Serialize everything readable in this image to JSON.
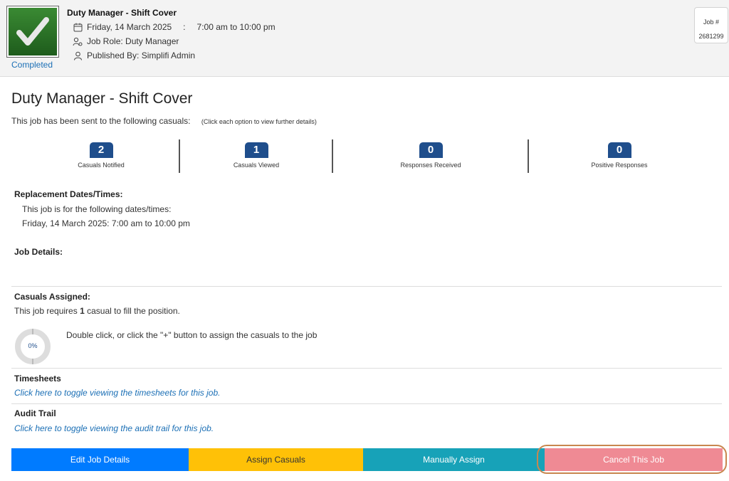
{
  "header": {
    "status_label": "Completed",
    "title": "Duty Manager - Shift Cover",
    "date": "Friday, 14 March 2025",
    "separator": ":",
    "time": "7:00 am to 10:00 pm",
    "job_role": "Job Role: Duty Manager",
    "published_by": "Published By: Simplifi Admin",
    "job_number_label": "Job #",
    "job_number": "2681299",
    "icons": [
      "check-icon",
      "calendar-icon",
      "role-icon",
      "person-icon"
    ]
  },
  "main": {
    "title": "Duty Manager - Shift Cover",
    "sent_text": "This job has been sent to the following casuals:",
    "sent_hint": "(Click each option to view further details)",
    "stats": [
      {
        "value": "2",
        "label": "Casuals Notified"
      },
      {
        "value": "1",
        "label": "Casuals Viewed"
      },
      {
        "value": "0",
        "label": "Responses Received"
      },
      {
        "value": "0",
        "label": "Positive Responses"
      }
    ],
    "replacement": {
      "label": "Replacement Dates/Times:",
      "intro": "This job is for the following dates/times:",
      "date_line": "Friday, 14 March 2025: 7:00 am to 10:00 pm"
    },
    "job_details_label": "Job Details:",
    "casuals_assigned": {
      "label": "Casuals Assigned:",
      "requires_prefix": "This job requires",
      "requires_count": "1",
      "requires_suffix": "casual to fill the position.",
      "progress_text": "0%",
      "progress_value": 0,
      "hint": "Double click, or click the \"+\" button to assign the casuals to the job"
    },
    "timesheets": {
      "label": "Timesheets",
      "link": "Click here to toggle viewing the timesheets for this job."
    },
    "audit": {
      "label": "Audit Trail",
      "link": "Click here to toggle viewing the audit trail for this job."
    }
  },
  "buttons": {
    "edit": "Edit Job Details",
    "assign": "Assign Casuals",
    "manual": "Manually Assign",
    "cancel": "Cancel This Job"
  },
  "colors": {
    "edit": "#007bff",
    "assign": "#ffc107",
    "manual": "#17a2b8",
    "cancel": "#ef8a94",
    "badge": "#1f4e8c",
    "link": "#1b6fb5"
  }
}
